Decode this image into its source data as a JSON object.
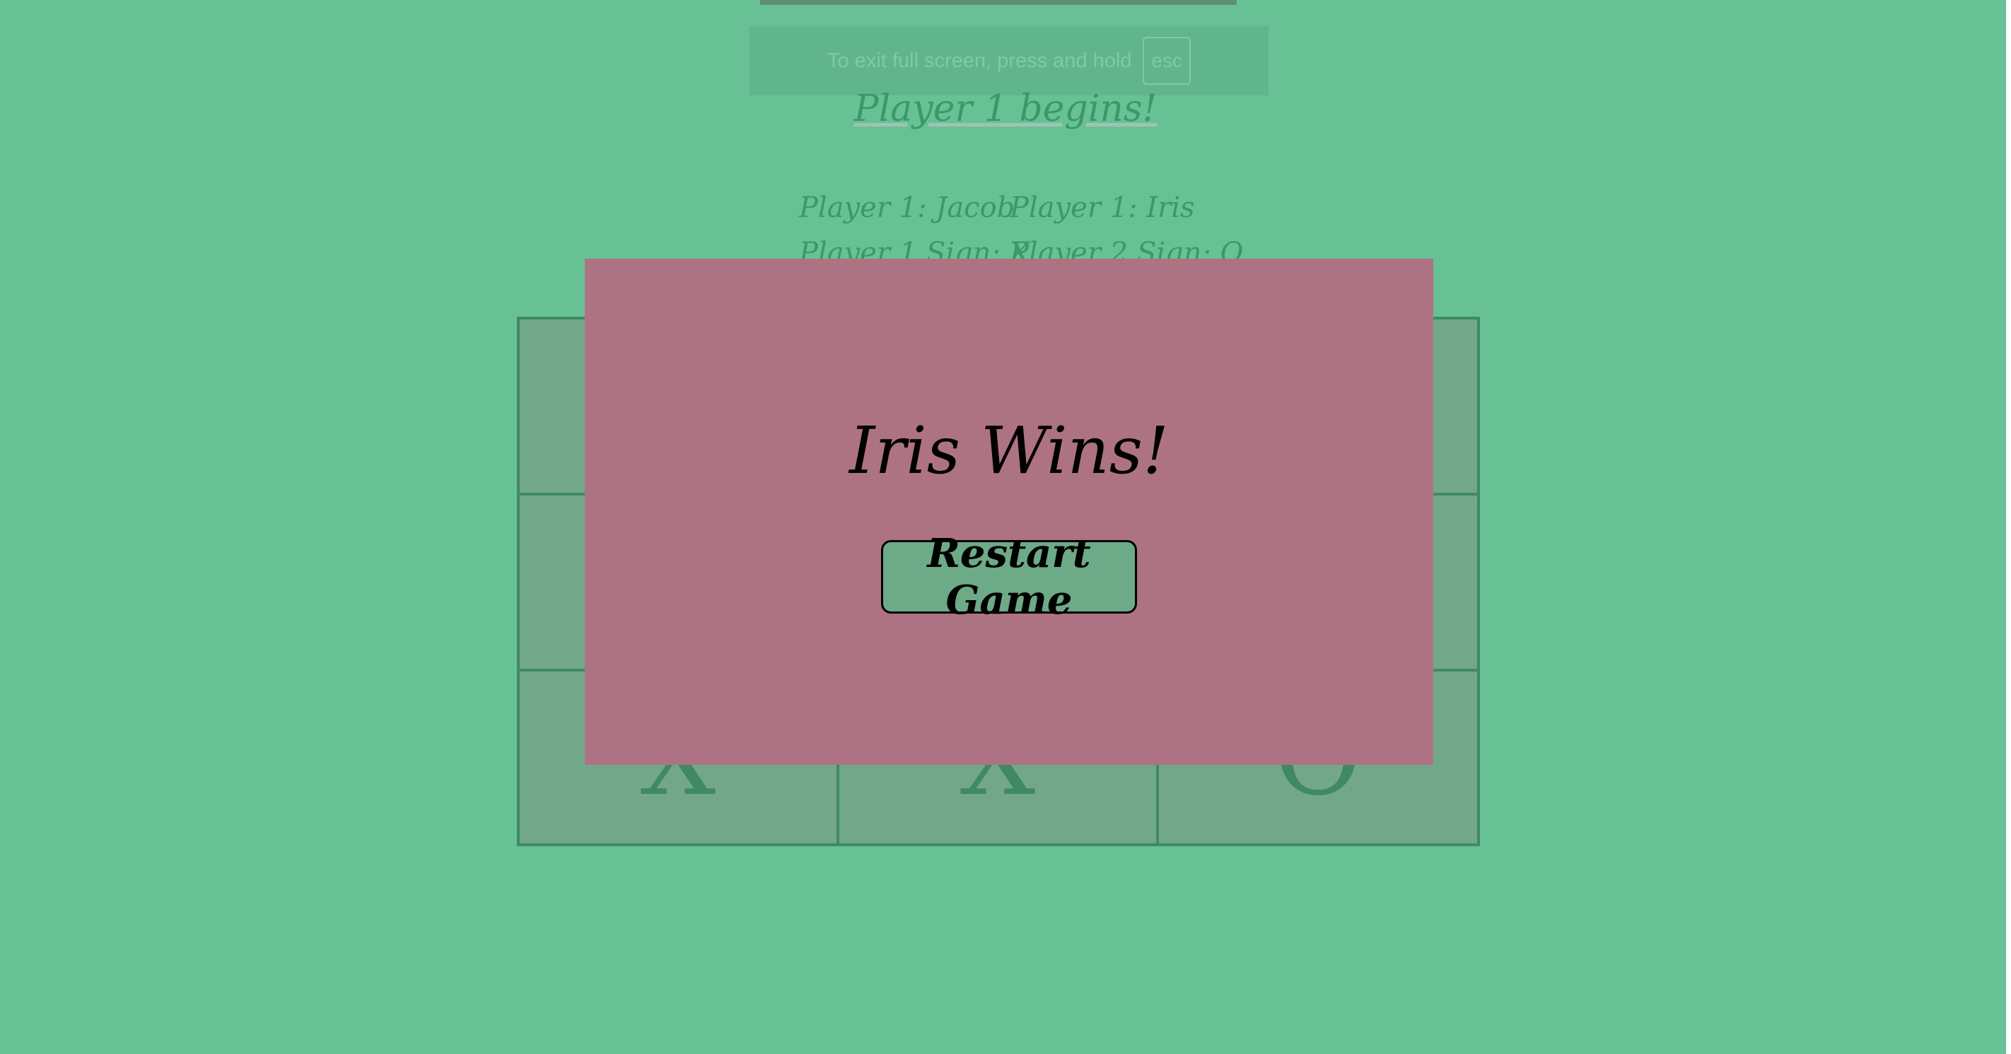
{
  "notice": {
    "text": "To exit full screen, press and hold",
    "key": "esc"
  },
  "game": {
    "status": "Player 1 begins!",
    "player1": {
      "name_line": "Player 1: Jacob",
      "sign_line": "Player 1 Sign: X"
    },
    "player2": {
      "name_line": "Player 1: Iris",
      "sign_line": "Player 2 Sign: O"
    },
    "board": [
      "",
      "",
      "",
      "",
      "",
      "",
      "X",
      "X",
      "O"
    ]
  },
  "modal": {
    "title": "Iris Wins!",
    "restart_label": "Restart Game"
  },
  "colors": {
    "background": "#68c195",
    "modal": "#ae7383",
    "button": "#6daa87",
    "board": "#72a889",
    "grid_lines": "#3f8a63"
  }
}
